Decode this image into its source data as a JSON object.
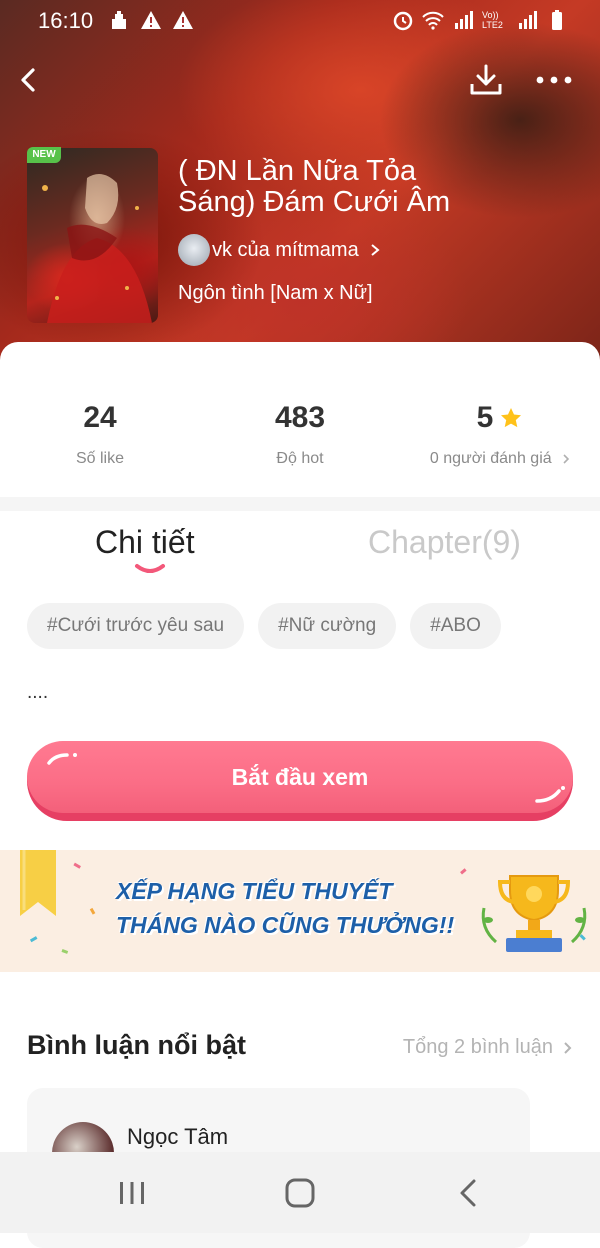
{
  "status_bar": {
    "time": "16:10",
    "network_label": "Vo)) LTE2"
  },
  "book": {
    "badge": "NEW",
    "title": "( ĐN Lần Nữa Tỏa Sáng) Đám Cưới Âm",
    "author": "vk của mítmama",
    "genre": "Ngôn tình [Nam x Nữ]"
  },
  "stats": {
    "likes_value": "24",
    "likes_label": "Số like",
    "hot_value": "483",
    "hot_label": "Độ hot",
    "rating_value": "5",
    "rating_label": "0 người đánh giá"
  },
  "tabs": {
    "detail": "Chi tiết",
    "chapters": "Chapter(9)"
  },
  "tags": [
    "#Cưới trước yêu sau",
    "#Nữ cường",
    "#ABO"
  ],
  "description": "....",
  "start_button": "Bắt đầu xem",
  "banner": {
    "line1": "XẾP HẠNG TIỂU THUYẾT",
    "line2": "THÁNG NÀO CŨNG THƯỞNG!!"
  },
  "comments": {
    "title": "Bình luận nổi bật",
    "total": "Tổng 2 bình luận",
    "items": [
      {
        "name": "Ngọc Tâm"
      }
    ]
  },
  "colors": {
    "accent": "#fb6d86",
    "banner_text": "#1d5fa8",
    "star": "#ffc21a"
  }
}
